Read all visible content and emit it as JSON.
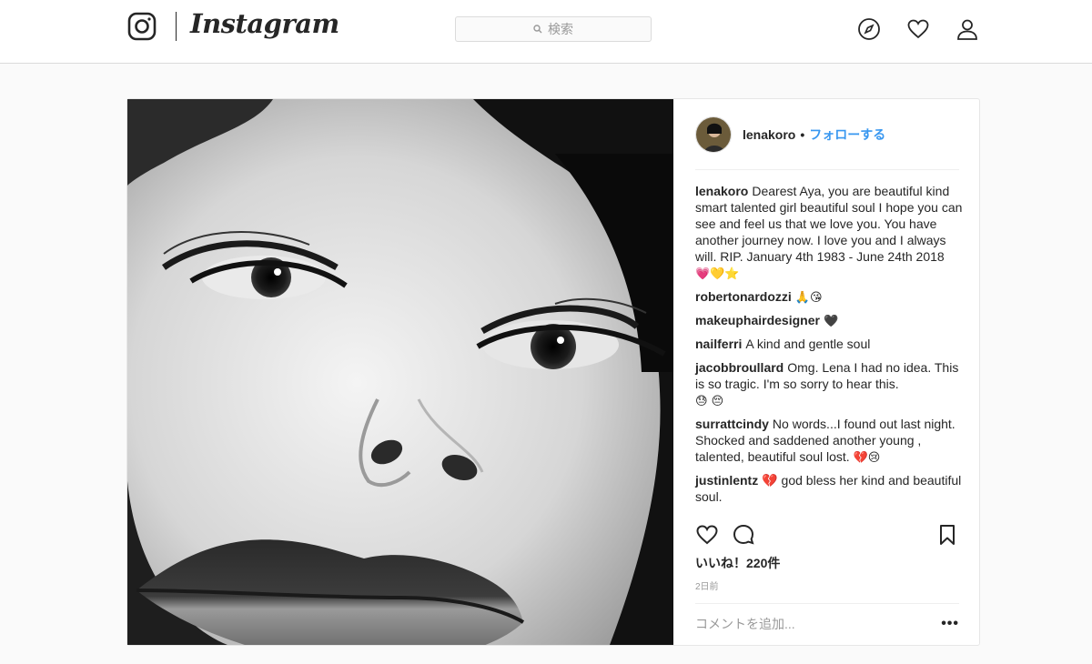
{
  "header": {
    "wordmark": "Instagram",
    "search_placeholder": "検索"
  },
  "post": {
    "username": "lenakoro",
    "separator": "•",
    "follow_label": "フォローする",
    "comments": [
      {
        "user": "lenakoro",
        "text": "Dearest Aya, you are beautiful kind smart talented girl beautiful soul I hope you can see and feel us that we love you. You have another journey now. I love you and I always will. RIP. January 4th 1983 - June 24th 2018",
        "emoji": "💗💛⭐"
      },
      {
        "user": "robertonardozzi",
        "text": "",
        "emoji": "🙏😘"
      },
      {
        "user": "makeuphairdesigner",
        "text": "",
        "emoji": "🖤"
      },
      {
        "user": "nailferri",
        "text": "A kind and gentle soul",
        "emoji": ""
      },
      {
        "user": "jacobbroullard",
        "text": "Omg. Lena I had no idea. This is so tragic. I'm so sorry to hear this.",
        "emoji": "😓 😔"
      },
      {
        "user": "surrattcindy",
        "text": "No words...I found out last night. Shocked and saddened another young , talented, beautiful soul lost.",
        "emoji": "💔😢"
      },
      {
        "user": "justinlentz",
        "text": "💔 god bless her kind and beautiful soul.",
        "emoji": ""
      }
    ],
    "likes": "いいね！220件",
    "time": "2日前",
    "add_comment_placeholder": "コメントを追加...",
    "more_label": "•••"
  },
  "icons": {
    "instagram": "instagram-logo-icon",
    "search": "search-icon",
    "explore": "compass-icon",
    "activity": "heart-icon",
    "profile": "user-icon",
    "like": "heart-outline-icon",
    "comment": "comment-bubble-icon",
    "save": "bookmark-icon"
  },
  "colors": {
    "link": "#3897f0",
    "text": "#262626",
    "muted": "#999999",
    "border": "#dbdbdb"
  }
}
